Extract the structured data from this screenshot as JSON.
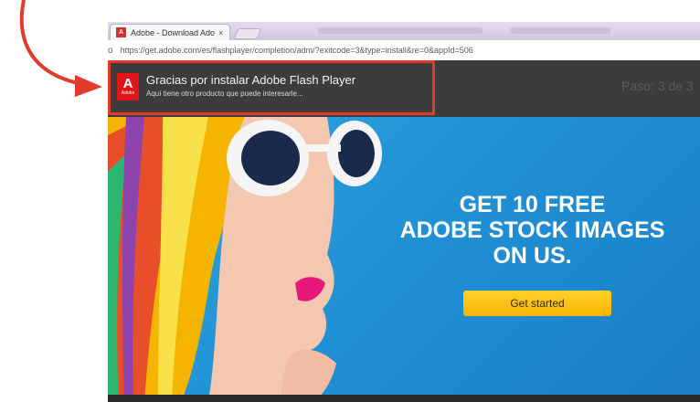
{
  "browser": {
    "tab": {
      "title": "Adobe - Download Adob",
      "favicon": "adobe-icon",
      "close_glyph": "×"
    },
    "address": {
      "nav_fragment": "o",
      "url": "https://get.adobe.com/es/flashplayer/completion/adm/?exitcode=3&type=install&re=0&appId=506"
    }
  },
  "header": {
    "logo_text": "Adobe",
    "title": "Gracias por instalar Adobe Flash Player",
    "subtitle": "Aquí tiene otro producto que puede interesarle...",
    "step": "Paso: 3 de 3"
  },
  "banner": {
    "headline_line1": "GET 10 FREE",
    "headline_line2": "ADOBE STOCK IMAGES",
    "headline_line3": "ON US.",
    "cta_label": "Get started"
  },
  "colors": {
    "highlight": "#e23b2b",
    "header_bg": "#3c3c3c",
    "banner_bg": "#1f8ed3",
    "cta": "#f4b400",
    "adobe_red": "#e1141c"
  }
}
